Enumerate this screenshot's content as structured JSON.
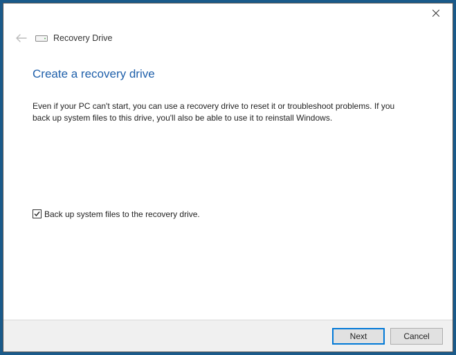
{
  "header": {
    "wizard_title": "Recovery Drive",
    "heading": "Create a recovery drive",
    "description": "Even if your PC can't start, you can use a recovery drive to reset it or troubleshoot problems. If you back up system files to this drive, you'll also be able to use it to reinstall Windows."
  },
  "checkbox": {
    "label": "Back up system files to the recovery drive.",
    "checked": true
  },
  "footer": {
    "next": "Next",
    "cancel": "Cancel"
  }
}
